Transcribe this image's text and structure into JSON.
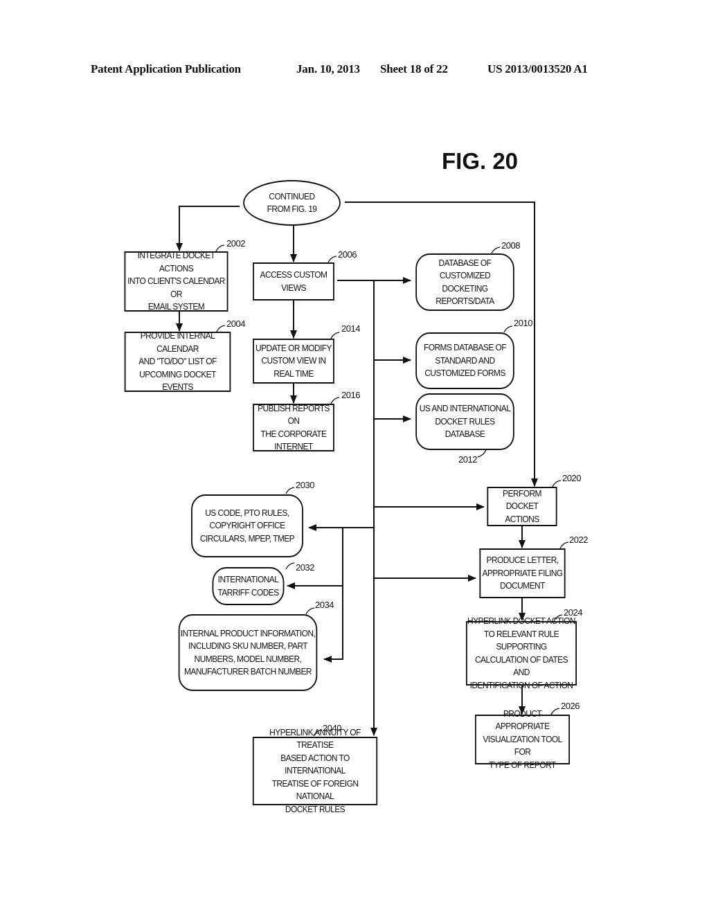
{
  "header": {
    "publication": "Patent Application Publication",
    "date": "Jan. 10, 2013",
    "sheet": "Sheet 18 of 22",
    "number": "US 2013/0013520 A1"
  },
  "figure": {
    "title": "FIG. 20",
    "nodes": {
      "start": {
        "label": "CONTINUED\nFROM FIG. 19",
        "shape": "oval"
      },
      "n2002": {
        "ref": "2002",
        "label": "INTEGRATE DOCKET ACTIONS\nINTO CLIENT'S CALENDAR OR\nEMAIL SYSTEM",
        "shape": "rect"
      },
      "n2004": {
        "ref": "2004",
        "label": "PROVIDE INTERNAL CALENDAR\nAND \"TO/DO\" LIST OF\nUPCOMING DOCKET EVENTS",
        "shape": "rect"
      },
      "n2006": {
        "ref": "2006",
        "label": "ACCESS CUSTOM\nVIEWS",
        "shape": "rect"
      },
      "n2014": {
        "ref": "2014",
        "label": "UPDATE OR MODIFY\nCUSTOM VIEW IN\nREAL TIME",
        "shape": "rect"
      },
      "n2016": {
        "ref": "2016",
        "label": "PUBLISH REPORTS ON\nTHE CORPORATE\nINTERNET",
        "shape": "rect"
      },
      "n2008": {
        "ref": "2008",
        "label": "DATABASE OF\nCUSTOMIZED DOCKETING\nREPORTS/DATA",
        "shape": "rounded"
      },
      "n2010": {
        "ref": "2010",
        "label": "FORMS DATABASE OF\nSTANDARD AND\nCUSTOMIZED FORMS",
        "shape": "rounded"
      },
      "n2012": {
        "ref": "2012",
        "label": "US AND INTERNATIONAL\nDOCKET RULES\nDATABASE",
        "shape": "rounded"
      },
      "n2020": {
        "ref": "2020",
        "label": "PERFORM\nDOCKET ACTIONS",
        "shape": "rect"
      },
      "n2022": {
        "ref": "2022",
        "label": "PRODUCE LETTER,\nAPPROPRIATE FILING\nDOCUMENT",
        "shape": "rect"
      },
      "n2024": {
        "ref": "2024",
        "label": "HYPERLINK DOCKET ACTION\nTO RELEVANT RULE SUPPORTING\nCALCULATION OF DATES AND\nIDENTIFICATION OF ACTION",
        "shape": "rect"
      },
      "n2026": {
        "ref": "2026",
        "label": "PRODUCT APPROPRIATE\nVISUALIZATION TOOL FOR\nTYPE OF REPORT",
        "shape": "rect"
      },
      "n2030": {
        "ref": "2030",
        "label": "US CODE, PTO RULES,\nCOPYRIGHT OFFICE\nCIRCULARS, MPEP, TMEP",
        "shape": "rounded"
      },
      "n2032": {
        "ref": "2032",
        "label": "INTERNATIONAL\nTARRIFF CODES",
        "shape": "rounded"
      },
      "n2034": {
        "ref": "2034",
        "label": "INTERNAL PRODUCT INFORMATION,\nINCLUDING SKU NUMBER, PART\nNUMBERS, MODEL NUMBER,\nMANUFACTURER BATCH NUMBER",
        "shape": "rounded"
      },
      "n2040": {
        "ref": "2040",
        "label": "HYPERLINK ANNUITY OF TREATISE\nBASED ACTION TO INTERNATIONAL\nTREATISE OF FOREIGN NATIONAL\nDOCKET RULES",
        "shape": "rect"
      }
    },
    "edges": [
      [
        "start",
        "n2002"
      ],
      [
        "start",
        "n2006"
      ],
      [
        "start",
        "n2020"
      ],
      [
        "n2002",
        "n2004"
      ],
      [
        "n2006",
        "n2014"
      ],
      [
        "n2014",
        "n2016"
      ],
      [
        "n2006",
        "n2008"
      ],
      [
        "n2006",
        "n2010"
      ],
      [
        "n2006",
        "n2012"
      ],
      [
        "n2006",
        "n2020"
      ],
      [
        "n2006",
        "n2022"
      ],
      [
        "n2006",
        "n2040"
      ],
      [
        "n2006",
        "n2030"
      ],
      [
        "n2006",
        "n2032"
      ],
      [
        "n2006",
        "n2034"
      ],
      [
        "n2020",
        "n2022"
      ],
      [
        "n2022",
        "n2024"
      ],
      [
        "n2024",
        "n2026"
      ]
    ]
  }
}
